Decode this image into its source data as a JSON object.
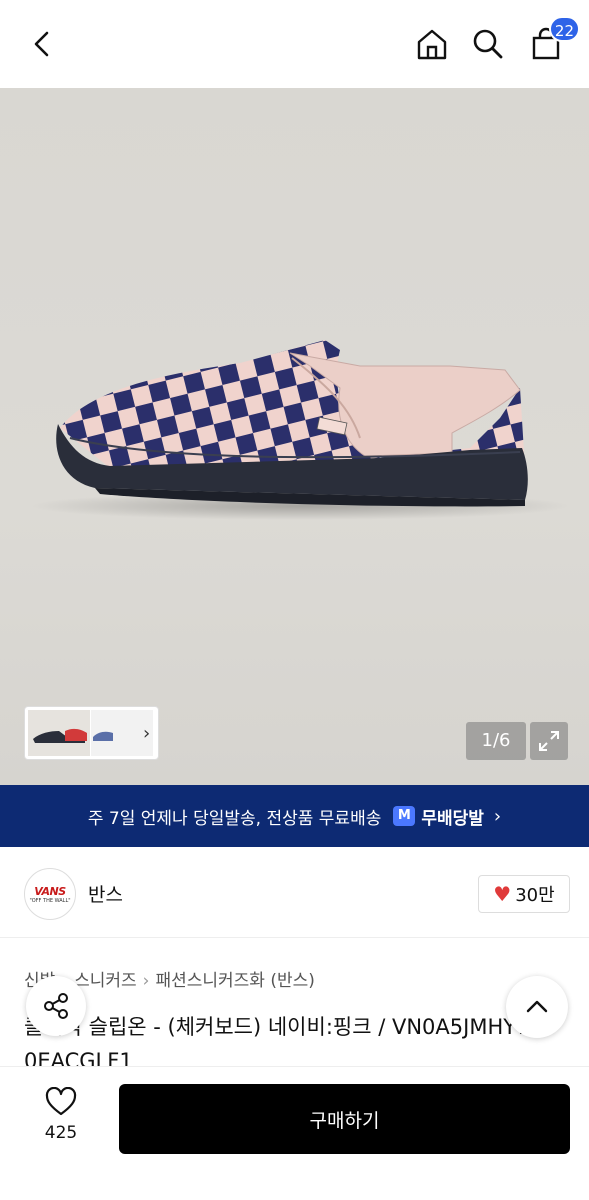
{
  "header": {
    "cart_count": "22"
  },
  "gallery": {
    "counter": "1/6"
  },
  "banner": {
    "text": "주 7일 언제나 당일발송, 전상품 무료배송",
    "logo_mark": "M",
    "logo_text": "무배당발",
    "chevron": "›"
  },
  "brand": {
    "logo_text": "VANS",
    "logo_tagline": "\"OFF THE WALL\"",
    "name": "반스",
    "like_count": "30만"
  },
  "breadcrumb": {
    "items": [
      "신발",
      "스니커즈",
      "패션스니커즈화 (반스)"
    ],
    "separator": "›"
  },
  "product": {
    "title": "클래식 슬립온 - (체커보드) 네이비:핑크 / VN0A5JMHY7V 0EACGLF1"
  },
  "bottom": {
    "wish_count": "425",
    "buy_label": "구매하기"
  },
  "colors": {
    "accent_badge": "#2e63e8",
    "banner_bg": "#0d2a73",
    "brand_red": "#c81b1b",
    "buy_bg": "#000000"
  }
}
